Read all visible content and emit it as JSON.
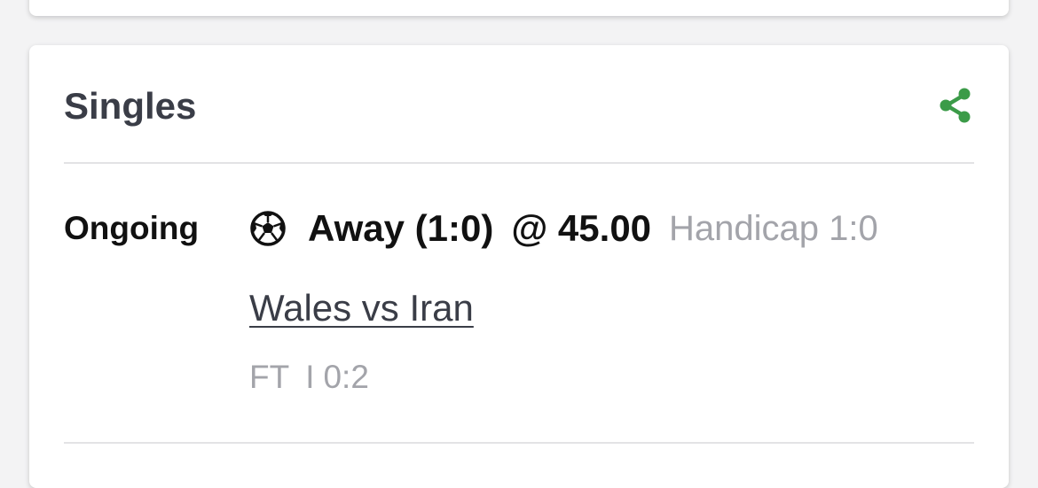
{
  "card": {
    "title": "Singles",
    "share_icon": "share-icon"
  },
  "bet": {
    "status": "Ongoing",
    "sport_icon": "soccer-ball-icon",
    "selection": "Away (1:0)",
    "odds_label": "@ 45.00",
    "market": "Handicap 1:0",
    "match": "Wales vs Iran",
    "match_state": "FT",
    "separator": "I",
    "score": "0:2"
  },
  "colors": {
    "share_icon": "#3b9b48",
    "title_text": "#3a3d47",
    "muted_text": "#a3a4aa"
  }
}
